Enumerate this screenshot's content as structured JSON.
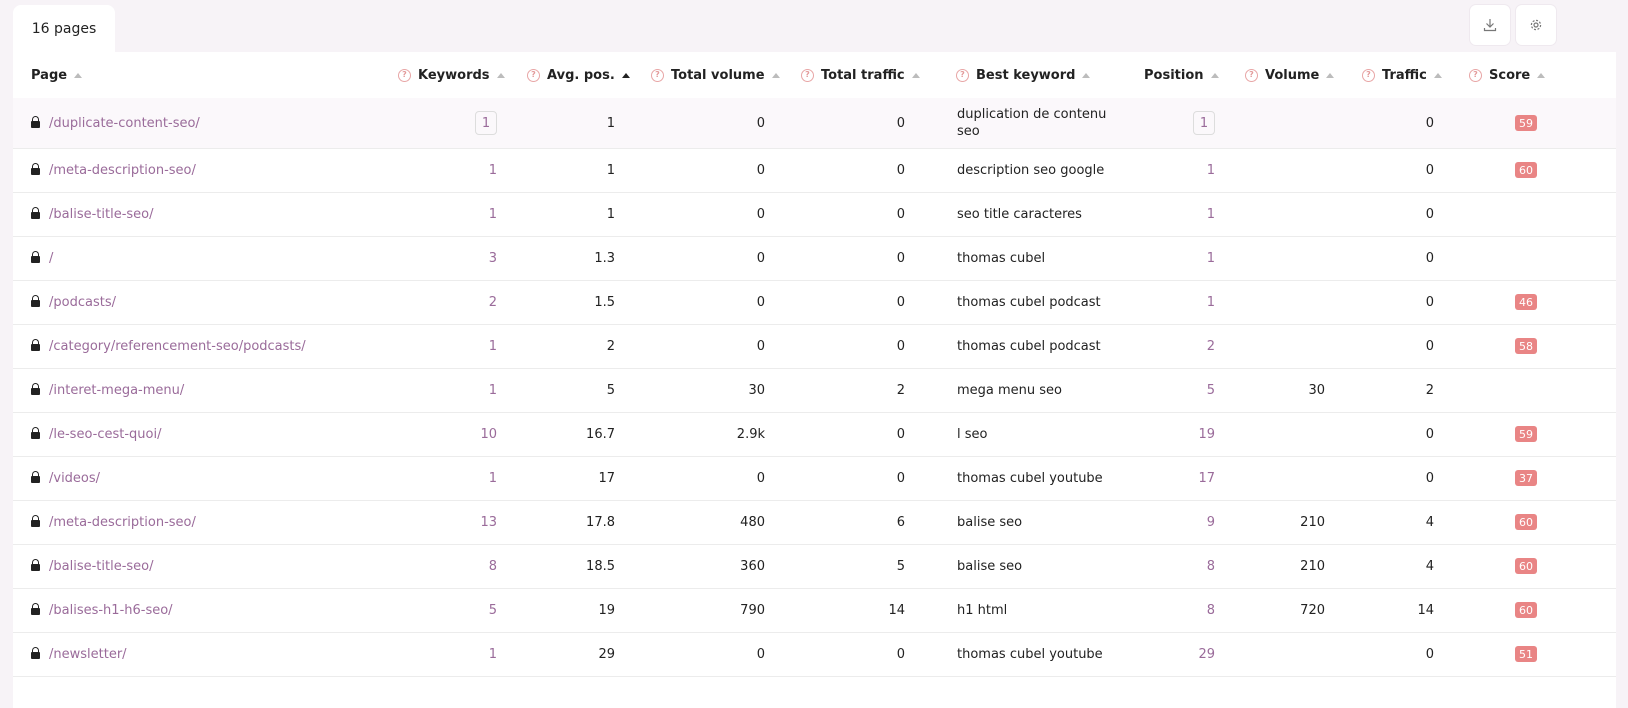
{
  "tab": {
    "label": "16 pages"
  },
  "toolbar": {
    "download_icon": "download-icon",
    "settings_icon": "gear-icon"
  },
  "columns": {
    "page": "Page",
    "keywords": "Keywords",
    "avg_pos": "Avg. pos.",
    "total_volume": "Total volume",
    "total_traffic": "Total traffic",
    "best_keyword": "Best keyword",
    "position": "Position",
    "volume": "Volume",
    "traffic": "Traffic",
    "score": "Score"
  },
  "colors": {
    "accent": "#9a6b9a",
    "badge": "#e98585",
    "help": "#e39b9b"
  },
  "rows": [
    {
      "page": "/duplicate-content-seo/",
      "keywords": "1",
      "avg_pos": "1",
      "total_volume": "0",
      "total_traffic": "0",
      "best_keyword": "duplication de contenu seo",
      "position": "1",
      "volume": "",
      "traffic": "0",
      "score": "59"
    },
    {
      "page": "/meta-description-seo/",
      "keywords": "1",
      "avg_pos": "1",
      "total_volume": "0",
      "total_traffic": "0",
      "best_keyword": "description seo google",
      "position": "1",
      "volume": "",
      "traffic": "0",
      "score": "60"
    },
    {
      "page": "/balise-title-seo/",
      "keywords": "1",
      "avg_pos": "1",
      "total_volume": "0",
      "total_traffic": "0",
      "best_keyword": "seo title caracteres",
      "position": "1",
      "volume": "",
      "traffic": "0",
      "score": ""
    },
    {
      "page": "/",
      "keywords": "3",
      "avg_pos": "1.3",
      "total_volume": "0",
      "total_traffic": "0",
      "best_keyword": "thomas cubel",
      "position": "1",
      "volume": "",
      "traffic": "0",
      "score": ""
    },
    {
      "page": "/podcasts/",
      "keywords": "2",
      "avg_pos": "1.5",
      "total_volume": "0",
      "total_traffic": "0",
      "best_keyword": "thomas cubel podcast",
      "position": "1",
      "volume": "",
      "traffic": "0",
      "score": "46"
    },
    {
      "page": "/category/referencement-seo/podcasts/",
      "keywords": "1",
      "avg_pos": "2",
      "total_volume": "0",
      "total_traffic": "0",
      "best_keyword": "thomas cubel podcast",
      "position": "2",
      "volume": "",
      "traffic": "0",
      "score": "58"
    },
    {
      "page": "/interet-mega-menu/",
      "keywords": "1",
      "avg_pos": "5",
      "total_volume": "30",
      "total_traffic": "2",
      "best_keyword": "mega menu seo",
      "position": "5",
      "volume": "30",
      "traffic": "2",
      "score": ""
    },
    {
      "page": "/le-seo-cest-quoi/",
      "keywords": "10",
      "avg_pos": "16.7",
      "total_volume": "2.9k",
      "total_traffic": "0",
      "best_keyword": "l seo",
      "position": "19",
      "volume": "",
      "traffic": "0",
      "score": "59"
    },
    {
      "page": "/videos/",
      "keywords": "1",
      "avg_pos": "17",
      "total_volume": "0",
      "total_traffic": "0",
      "best_keyword": "thomas cubel youtube",
      "position": "17",
      "volume": "",
      "traffic": "0",
      "score": "37"
    },
    {
      "page": "/meta-description-seo/",
      "keywords": "13",
      "avg_pos": "17.8",
      "total_volume": "480",
      "total_traffic": "6",
      "best_keyword": "balise seo",
      "position": "9",
      "volume": "210",
      "traffic": "4",
      "score": "60"
    },
    {
      "page": "/balise-title-seo/",
      "keywords": "8",
      "avg_pos": "18.5",
      "total_volume": "360",
      "total_traffic": "5",
      "best_keyword": "balise seo",
      "position": "8",
      "volume": "210",
      "traffic": "4",
      "score": "60"
    },
    {
      "page": "/balises-h1-h6-seo/",
      "keywords": "5",
      "avg_pos": "19",
      "total_volume": "790",
      "total_traffic": "14",
      "best_keyword": "h1 html",
      "position": "8",
      "volume": "720",
      "traffic": "14",
      "score": "60"
    },
    {
      "page": "/newsletter/",
      "keywords": "1",
      "avg_pos": "29",
      "total_volume": "0",
      "total_traffic": "0",
      "best_keyword": "thomas cubel youtube",
      "position": "29",
      "volume": "",
      "traffic": "0",
      "score": "51"
    }
  ]
}
